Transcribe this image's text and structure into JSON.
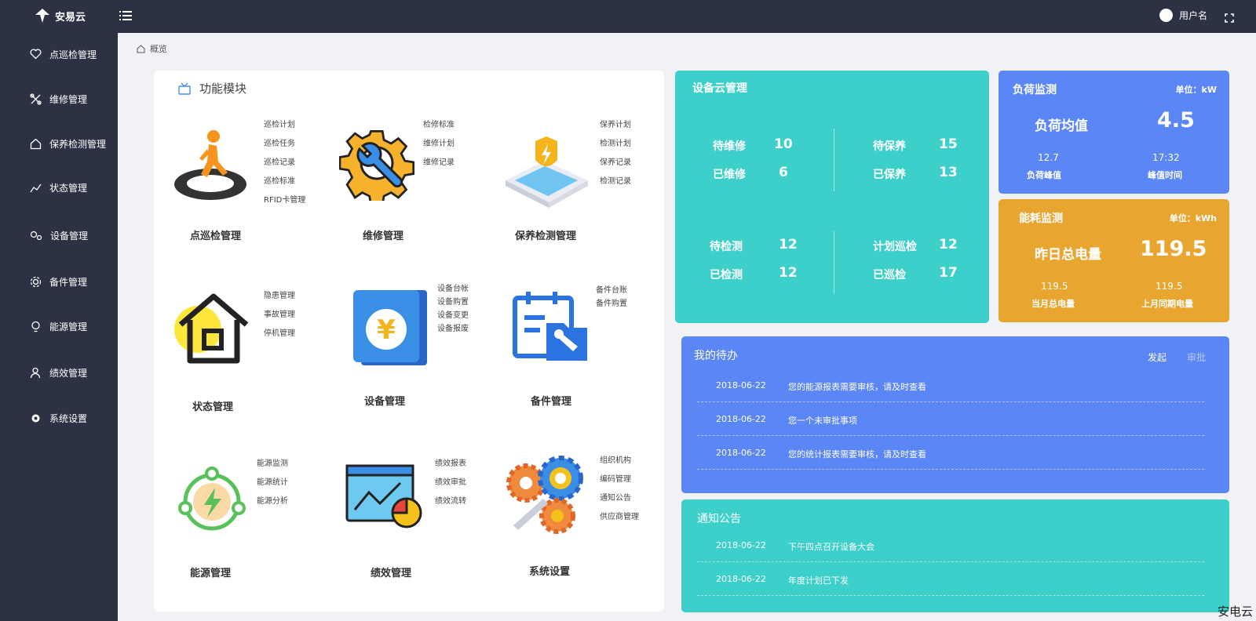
{
  "header": {
    "brand": "安易云",
    "username": "用户名"
  },
  "sidebar": {
    "items": [
      {
        "label": "点巡检管理",
        "icon": "heart-icon"
      },
      {
        "label": "维修管理",
        "icon": "tools-icon"
      },
      {
        "label": "保养检测管理",
        "icon": "home-icon"
      },
      {
        "label": "状态管理",
        "icon": "line-chart-icon"
      },
      {
        "label": "设备管理",
        "icon": "gears-icon"
      },
      {
        "label": "备件管理",
        "icon": "gear-icon"
      },
      {
        "label": "能源管理",
        "icon": "bulb-icon"
      },
      {
        "label": "绩效管理",
        "icon": "user-icon"
      },
      {
        "label": "系统设置",
        "icon": "settings-icon"
      }
    ]
  },
  "breadcrumb": {
    "label": "概览"
  },
  "modules": {
    "title": "功能模块",
    "items": [
      {
        "name": "点巡检管理",
        "links": [
          "巡检计划",
          "巡检任务",
          "巡检记录",
          "巡检标准",
          "RFID卡管理"
        ]
      },
      {
        "name": "维修管理",
        "links": [
          "检修标准",
          "维修计划",
          "维修记录"
        ]
      },
      {
        "name": "保养检测管理",
        "links": [
          "保养计划",
          "检测计划",
          "保养记录",
          "检测记录"
        ]
      },
      {
        "name": "状态管理",
        "links": [
          "隐患管理",
          "事故管理",
          "停机管理"
        ]
      },
      {
        "name": "设备管理",
        "links": [
          "设备台帐",
          "设备购置",
          "设备变更",
          "设备报废"
        ]
      },
      {
        "name": "备件管理",
        "links": [
          "备件台账",
          "备件购置"
        ]
      },
      {
        "name": "能源管理",
        "links": [
          "能源监测",
          "能源统计",
          "能源分析"
        ]
      },
      {
        "name": "绩效管理",
        "links": [
          "绩效报表",
          "绩效审批",
          "绩效流转"
        ]
      },
      {
        "name": "系统设置",
        "links": [
          "组织机构",
          "编码管理",
          "通知公告",
          "供应商管理"
        ]
      }
    ]
  },
  "device_cloud": {
    "title": "设备云管理",
    "stats": [
      {
        "label": "待维修",
        "value": "10"
      },
      {
        "label": "已维修",
        "value": "6"
      },
      {
        "label": "待保养",
        "value": "15"
      },
      {
        "label": "已保养",
        "value": "13"
      },
      {
        "label": "待检测",
        "value": "12"
      },
      {
        "label": "已检测",
        "value": "12"
      },
      {
        "label": "计划巡检",
        "value": "12"
      },
      {
        "label": "已巡检",
        "value": "17"
      }
    ]
  },
  "load": {
    "title": "负荷监测",
    "unit": "单位：kW",
    "main_label": "负荷均值",
    "main_value": "4.5",
    "peak_value": "12.7",
    "peak_label": "负荷峰值",
    "time_value": "17:32",
    "time_label": "峰值时间"
  },
  "energy": {
    "title": "能耗监测",
    "unit": "单位：kWh",
    "main_label": "昨日总电量",
    "main_value": "119.5",
    "month_value": "119.5",
    "month_label": "当月总电量",
    "last_value": "119.5",
    "last_label": "上月同期电量"
  },
  "todo": {
    "title": "我的待办",
    "tab_initiate": "发起",
    "tab_approve": "审批",
    "rows": [
      {
        "date": "2018-06-22",
        "text": "您的能源报表需要审核，请及时查看"
      },
      {
        "date": "2018-06-22",
        "text": "您一个未审批事项"
      },
      {
        "date": "2018-06-22",
        "text": "您的统计报表需要审核，请及时查看"
      }
    ]
  },
  "notice": {
    "title": "通知公告",
    "rows": [
      {
        "date": "2018-06-22",
        "text": "下午四点召开设备大会"
      },
      {
        "date": "2018-06-22",
        "text": "年度计划已下发"
      }
    ]
  },
  "watermark": "安电云",
  "colors": {
    "teal": "#3dcfc9",
    "blue": "#5b86f6",
    "orange": "#e8a630",
    "sidebar": "#2c3244"
  }
}
